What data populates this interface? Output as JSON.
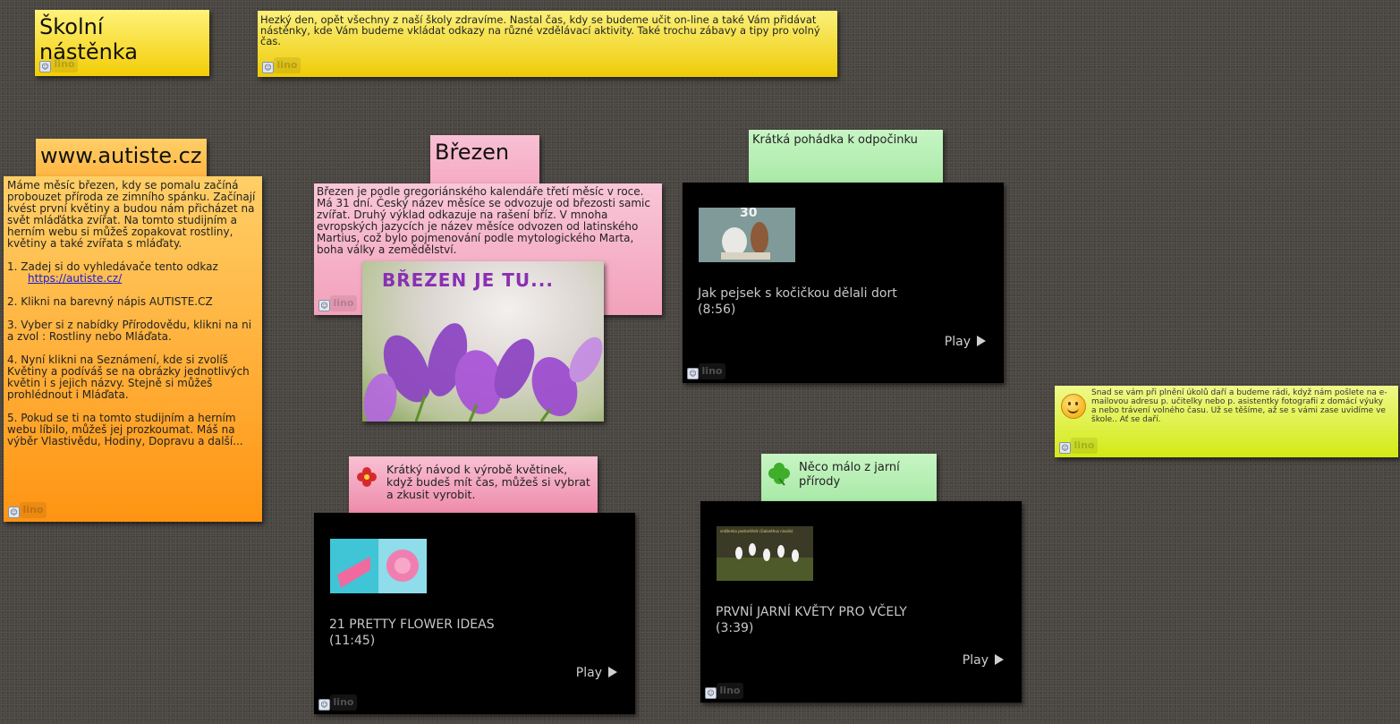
{
  "board": {
    "colors": {
      "background": "#4a4642",
      "yellow": "#f3cd06",
      "orange": "#ff9412",
      "pink": "#ee8aa9",
      "green": "#a8e9a6",
      "lime": "#d3ea14"
    }
  },
  "notes": {
    "title": {
      "text": "Školní nástěnka"
    },
    "intro": {
      "text": "Hezký den, opět všechny z naší školy zdravíme. Nastal čas, kdy se budeme učit on-line a také Vám přidávat nástěnky, kde Vám budeme vkládat odkazy na různé vzdělávací aktivity. Také trochu zábavy a tipy pro volný čas."
    },
    "autiste_title": {
      "text": "www.autiste.cz"
    },
    "autiste_body": {
      "paragraph1": "Máme měsíc březen, kdy se pomalu začíná probouzet příroda ze zimního spánku. Začínají kvést první květiny a budou nám přicházet na svět mláďátka zvířat. Na tomto studijním a herním webu si můžeš zopakovat rostliny, květiny a také zvířata s mláďaty.",
      "step1": "1. Zadej si do vyhledávače tento odkaz",
      "link": "https://autiste.cz/",
      "step2": "2. Klikni na barevný nápis AUTISTE.CZ",
      "step3": "3. Vyber si z nabídky Přírodovědu, klikni na ni a zvol : Rostliny nebo Mláďata.",
      "step4": "4. Nyní klikni na Seznámení, kde si zvolíš Květiny a podíváš se na obrázky jednotlivých květin i s jejich názvy. Stejně si můžeš prohlédnout i Mláďata.",
      "step5": "5. Pokud se ti na tomto studijním a herním webu líbilo, můžeš jej prozkoumat. Máš na výběr Vlastivědu, Hodiny, Dopravu a další..."
    },
    "brezen_title": {
      "text": "Březen"
    },
    "brezen_body": {
      "text": "Březen je podle gregoriánského kalendáře třetí měsíc v roce. Má 31 dní. Český název měsíce se odvozuje od březosti samic zvířat. Druhý výklad odkazuje na rašení bříz. V mnoha evropských jazycích je název měsíce odvozen od latinského Martius, což bylo pojmenování podle mytologického Marta, boha války a zemědělství.",
      "image_caption": "BŘEZEN JE TU..."
    },
    "fairy_title": {
      "text": "Krátká pohádka k odpočinku"
    },
    "fairy_video": {
      "title": "Jak pejsek s kočičkou dělali dort",
      "duration": "(8:56)",
      "play": "Play",
      "thumb_label": "30"
    },
    "flower_title": {
      "text": "Krátký návod k výrobě květinek, když budeš mít čas, můžeš si vybrat a zkusit vyrobit."
    },
    "flower_video": {
      "title": "21 PRETTY FLOWER IDEAS",
      "duration": "(11:45)",
      "play": "Play"
    },
    "spring_title": {
      "text": "Něco málo z jarní přírody"
    },
    "spring_video": {
      "title": "PRVNÍ JARNÍ KVĚTY PRO VČELY",
      "duration": "(3:39)",
      "play": "Play",
      "thumb_label": "sněženka podsněžník (Galanthus nivalis)"
    },
    "goodbye": {
      "text": "Snad se vám při plnění úkolů daří a budeme rádi, když nám pošlete na e-mailovou adresu p. učitelky nebo p. asistentky fotografii z domácí výuky a nebo trávení volného času. Už se těšíme, až se s vámi zase uvidíme ve škole.. Ať se daří."
    }
  },
  "watermark": "lino"
}
